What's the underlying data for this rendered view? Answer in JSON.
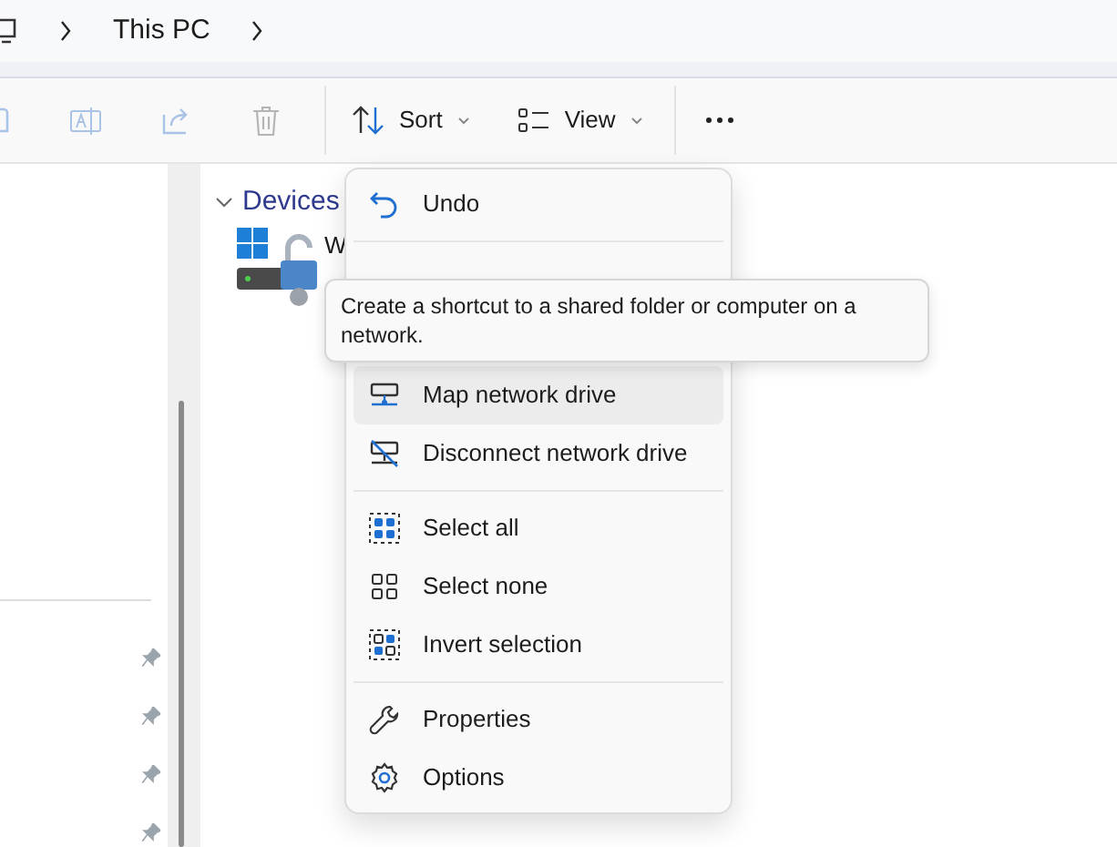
{
  "breadcrumb": {
    "items": [
      "This PC"
    ]
  },
  "toolbar": {
    "sort": "Sort",
    "view": "View"
  },
  "devices": {
    "header": "Devices",
    "expanded": true,
    "items": [
      {
        "name": "W"
      }
    ]
  },
  "sidebar": {
    "items": [
      {
        "pinned": true
      },
      {
        "pinned": true
      },
      {
        "pinned": true
      },
      {
        "pinned": true
      }
    ]
  },
  "menu": {
    "groups": [
      [
        {
          "label": "Undo",
          "selected": false
        }
      ],
      [
        {
          "label": "Map network drive",
          "selected": true
        },
        {
          "label": "Disconnect network drive",
          "selected": false
        }
      ],
      [
        {
          "label": "Select all",
          "selected": false
        },
        {
          "label": "Select none",
          "selected": false
        },
        {
          "label": "Invert selection",
          "selected": false
        }
      ],
      [
        {
          "label": "Properties",
          "selected": false
        },
        {
          "label": "Options",
          "selected": false
        }
      ]
    ]
  },
  "tooltip": {
    "text": "Create a shortcut to a shared folder or computer on a network."
  }
}
